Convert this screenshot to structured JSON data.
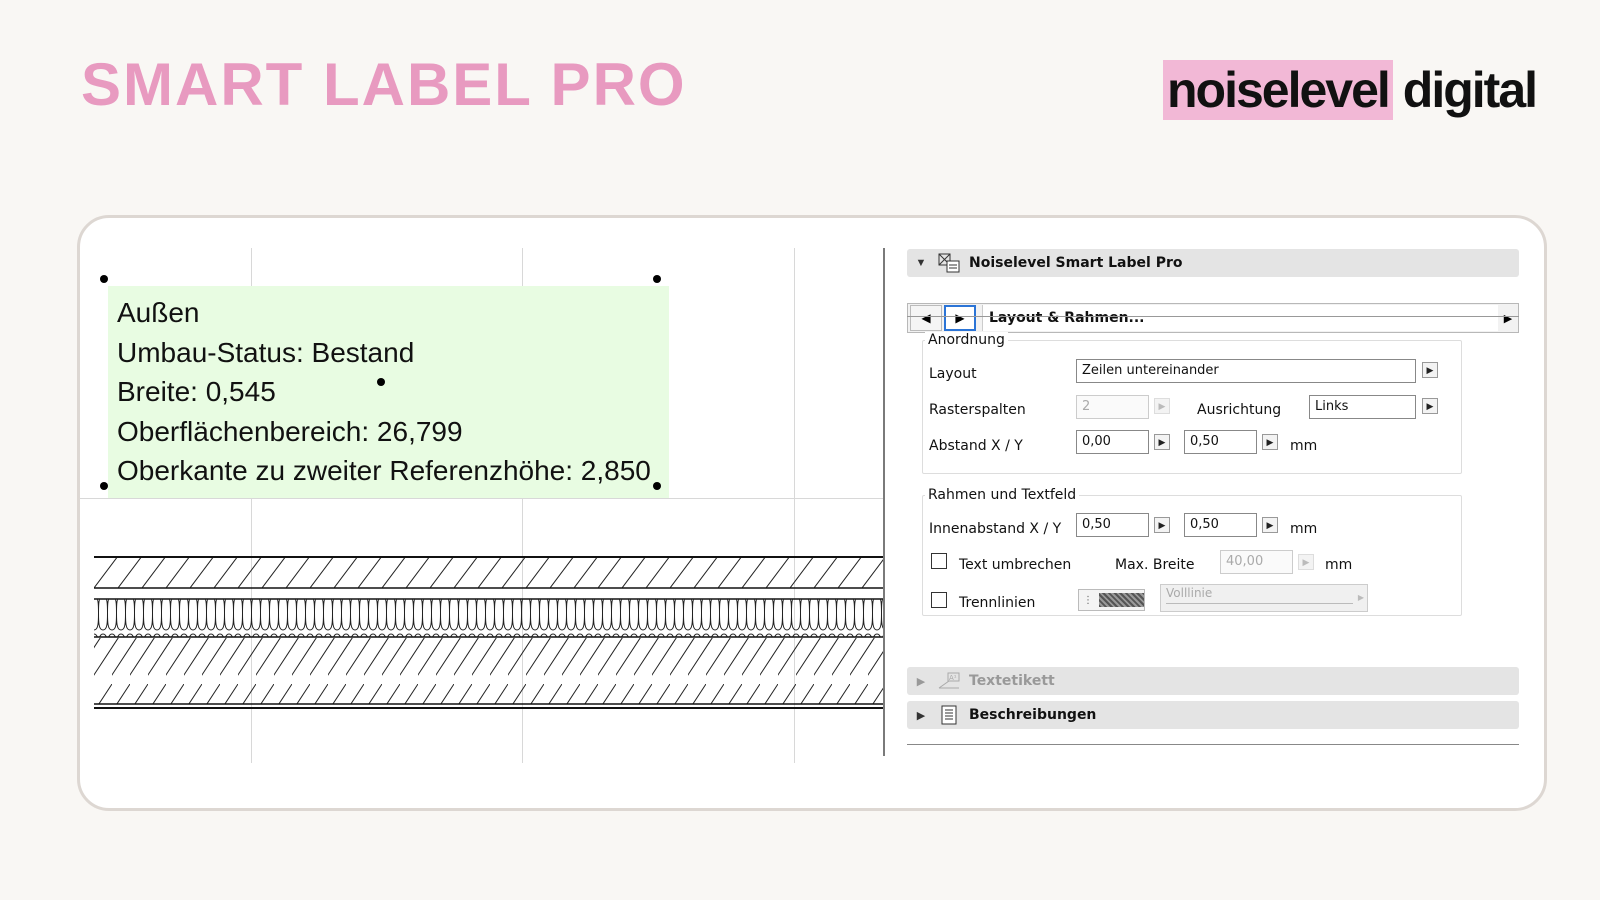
{
  "header": {
    "title": "SMART LABEL PRO",
    "brand_highlight": "noiselevel",
    "brand_rest": "digital"
  },
  "label": {
    "lines": [
      "Außen",
      "Umbau-Status: Bestand",
      "Breite: 0,545",
      "Oberflächenbereich: 26,799",
      "Oberkante zu zweiter Referenzhöhe: 2,850"
    ]
  },
  "panel": {
    "section_title": "Noiselevel Smart Label Pro",
    "nav_label": "Layout & Rahmen...",
    "anordnung": {
      "title": "Anordnung",
      "layout_label": "Layout",
      "layout_value": "Zeilen untereinander",
      "rasterspalten_label": "Rasterspalten",
      "rasterspalten_value": "2",
      "ausrichtung_label": "Ausrichtung",
      "ausrichtung_value": "Links",
      "abstand_label": "Abstand X / Y",
      "abstand_x": "0,00",
      "abstand_y": "0,50",
      "unit": "mm"
    },
    "rahmen": {
      "title": "Rahmen und Textfeld",
      "innenabstand_label": "Innenabstand X / Y",
      "innen_x": "0,50",
      "innen_y": "0,50",
      "unit": "mm",
      "umbrechen_label": "Text umbrechen",
      "max_breite_label": "Max. Breite",
      "max_breite_value": "40,00",
      "trennlinien_label": "Trennlinien",
      "linetype_value": "Volllinie"
    },
    "textetikett_label": "Textetikett",
    "beschreibungen_label": "Beschreibungen"
  },
  "colors": {
    "accent_pink": "#e89ac0",
    "brand_highlight": "#f2b8d6",
    "label_bg": "#e8fce2",
    "selection_blue": "#2b74d6"
  }
}
